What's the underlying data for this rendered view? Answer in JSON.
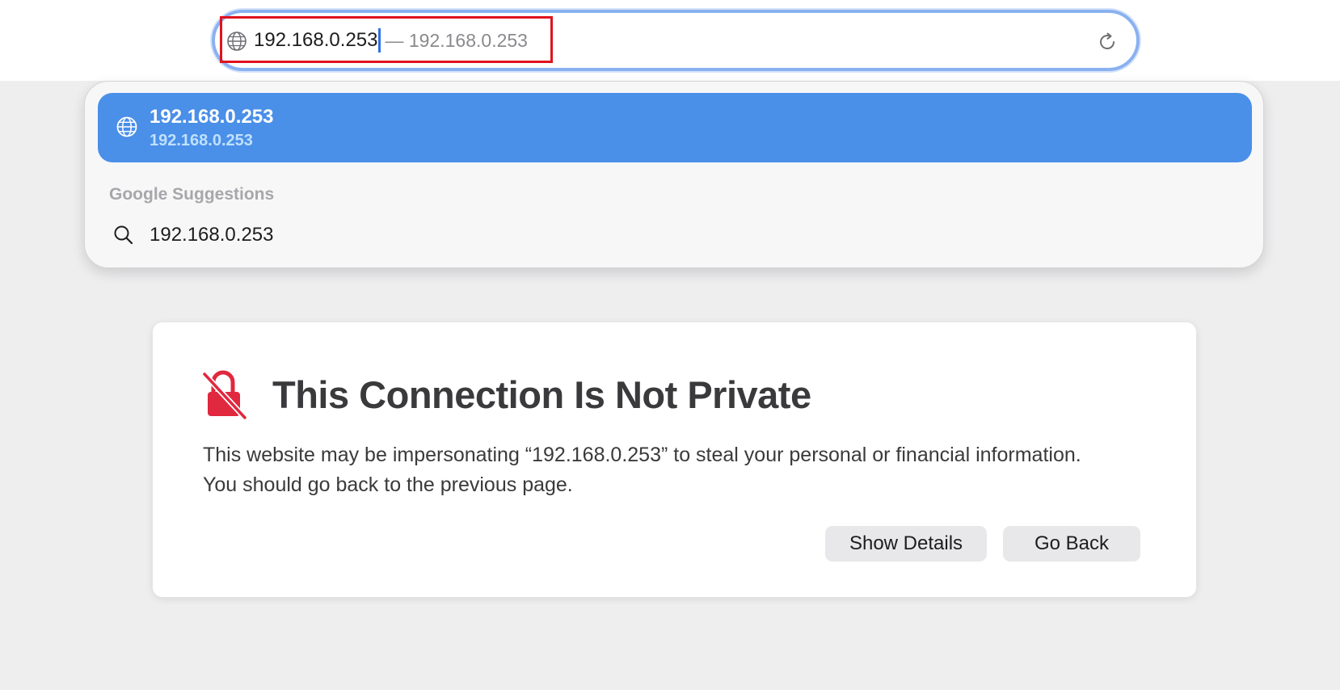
{
  "address_bar": {
    "typed_text": "192.168.0.253",
    "autocomplete_suffix": "— 192.168.0.253",
    "globe_icon": "globe-icon",
    "reload_icon": "reload-icon"
  },
  "dropdown": {
    "top_hit": {
      "title": "192.168.0.253",
      "subtitle": "192.168.0.253",
      "icon": "globe-icon"
    },
    "section_heading": "Google Suggestions",
    "suggestions": [
      {
        "text": "192.168.0.253",
        "icon": "search-icon"
      }
    ]
  },
  "error_card": {
    "icon": "unlocked-lock-icon",
    "title": "This Connection Is Not Private",
    "message": "This website may be impersonating “192.168.0.253” to steal your personal or financial information. You should go back to the previous page.",
    "show_details_label": "Show Details",
    "go_back_label": "Go Back"
  },
  "colors": {
    "accent": "#4a8fe8",
    "warning": "#e0283e",
    "highlight_box": "#e0121e"
  }
}
